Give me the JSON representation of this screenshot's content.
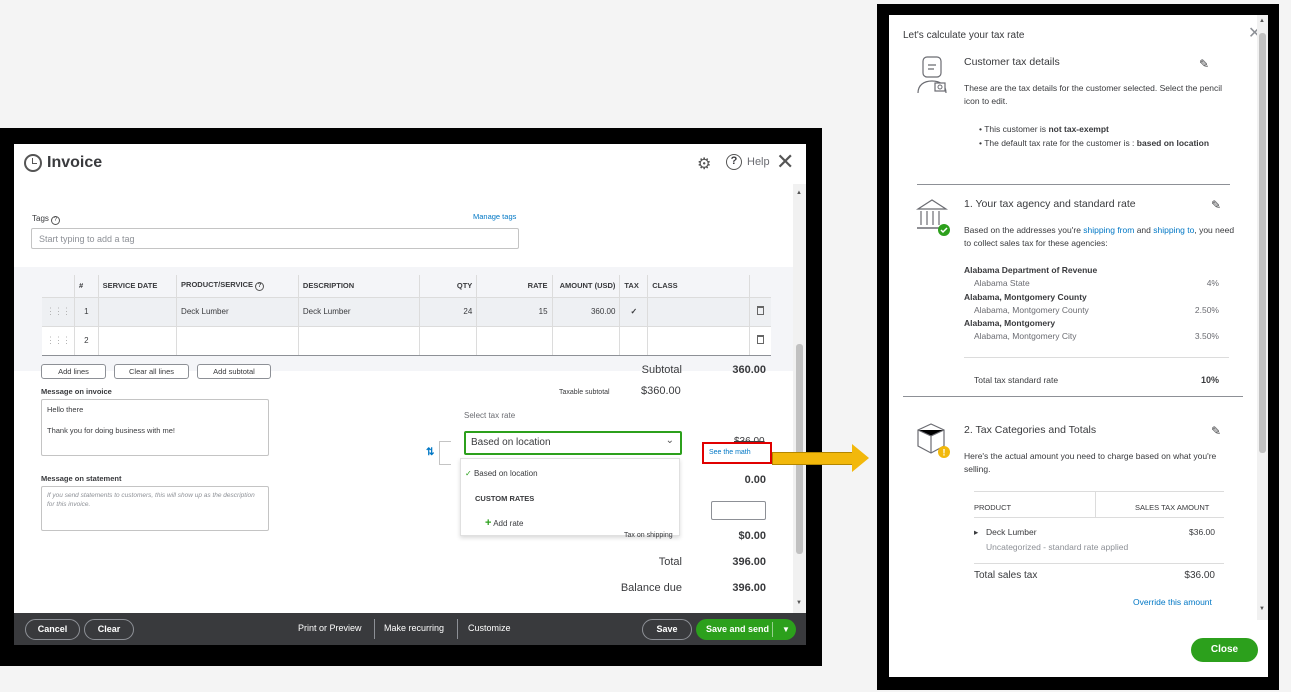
{
  "invoice": {
    "title": "Invoice",
    "help_label": "Help",
    "tags_label": "Tags",
    "manage_tags": "Manage tags",
    "tags_placeholder": "Start typing to add a tag",
    "table": {
      "headers": [
        "#",
        "SERVICE DATE",
        "PRODUCT/SERVICE",
        "DESCRIPTION",
        "QTY",
        "RATE",
        "AMOUNT (USD)",
        "TAX",
        "CLASS"
      ],
      "rows": [
        {
          "num": "1",
          "service_date": "",
          "product": "Deck Lumber",
          "description": "Deck Lumber",
          "qty": "24",
          "rate": "15",
          "amount": "360.00",
          "tax": "✓",
          "class": ""
        },
        {
          "num": "2",
          "service_date": "",
          "product": "",
          "description": "",
          "qty": "",
          "rate": "",
          "amount": "",
          "tax": "",
          "class": ""
        }
      ]
    },
    "buttons": {
      "add_lines": "Add lines",
      "clear_all_lines": "Clear all lines",
      "add_subtotal": "Add subtotal"
    },
    "message_on_invoice_label": "Message on invoice",
    "message_on_invoice_line1": "Hello there",
    "message_on_invoice_line2": "Thank you for doing business with me!",
    "message_on_statement_label": "Message on statement",
    "message_on_statement_placeholder": "If you send statements to customers, this will show up as the description for this invoice.",
    "subtotal_label": "Subtotal",
    "subtotal_value": "360.00",
    "taxable_subtotal_label": "Taxable subtotal",
    "taxable_subtotal_value": "$360.00",
    "select_tax_rate_label": "Select tax rate",
    "selected_tax_rate": "Based on location",
    "dropdown": {
      "option": "Based on location",
      "custom_header": "CUSTOM RATES",
      "add_rate": "Add rate"
    },
    "obscured_value": "$36.00",
    "see_the_math": "See the math",
    "discount_value": "0.00",
    "tax_on_shipping_label": "Tax on shipping",
    "tax_on_shipping_value": "$0.00",
    "total_label": "Total",
    "total_value": "396.00",
    "balance_due_label": "Balance due",
    "balance_due_value": "396.00",
    "footer": {
      "cancel": "Cancel",
      "clear": "Clear",
      "print_preview": "Print or Preview",
      "make_recurring": "Make recurring",
      "customize": "Customize",
      "save": "Save",
      "save_and_send": "Save and send"
    }
  },
  "tax_panel": {
    "title": "Let's calculate your tax rate",
    "customer_section": {
      "heading": "Customer tax details",
      "description": "These are the tax details for the customer selected. Select the pencil icon to edit.",
      "bullet1_prefix": "This customer is ",
      "bullet1_bold": "not tax-exempt",
      "bullet2_prefix": "The default tax rate for the customer is : ",
      "bullet2_bold": "based on location"
    },
    "agency_section": {
      "heading": "1. Your tax agency and standard rate",
      "text_prefix": "Based on the addresses you're ",
      "link1": "shipping from",
      "text_mid": " and ",
      "link2": "shipping to",
      "text_suffix": ", you need to collect sales tax for these agencies:",
      "agencies": [
        {
          "name": "Alabama Department of Revenue",
          "jurisdiction": "Alabama State",
          "rate": "4%"
        },
        {
          "name": "Alabama, Montgomery County",
          "jurisdiction": "Alabama, Montgomery County",
          "rate": "2.50%"
        },
        {
          "name": "Alabama, Montgomery",
          "jurisdiction": "Alabama, Montgomery City",
          "rate": "3.50%"
        }
      ],
      "total_label": "Total tax standard rate",
      "total_value": "10%"
    },
    "categories_section": {
      "heading": "2. Tax Categories and Totals",
      "description": "Here's the actual amount you need to charge based on what you're selling.",
      "col_product": "PRODUCT",
      "col_amount": "SALES TAX AMOUNT",
      "item_name": "Deck Lumber",
      "item_amount": "$36.00",
      "item_note": "Uncategorized - standard rate applied",
      "total_label": "Total sales tax",
      "total_value": "$36.00",
      "override_link": "Override this amount"
    },
    "close_button": "Close"
  },
  "colors": {
    "accent_green": "#2ca01c",
    "link_blue": "#0077c5",
    "highlight_red": "#e00000",
    "arrow_yellow": "#f2b80b"
  }
}
